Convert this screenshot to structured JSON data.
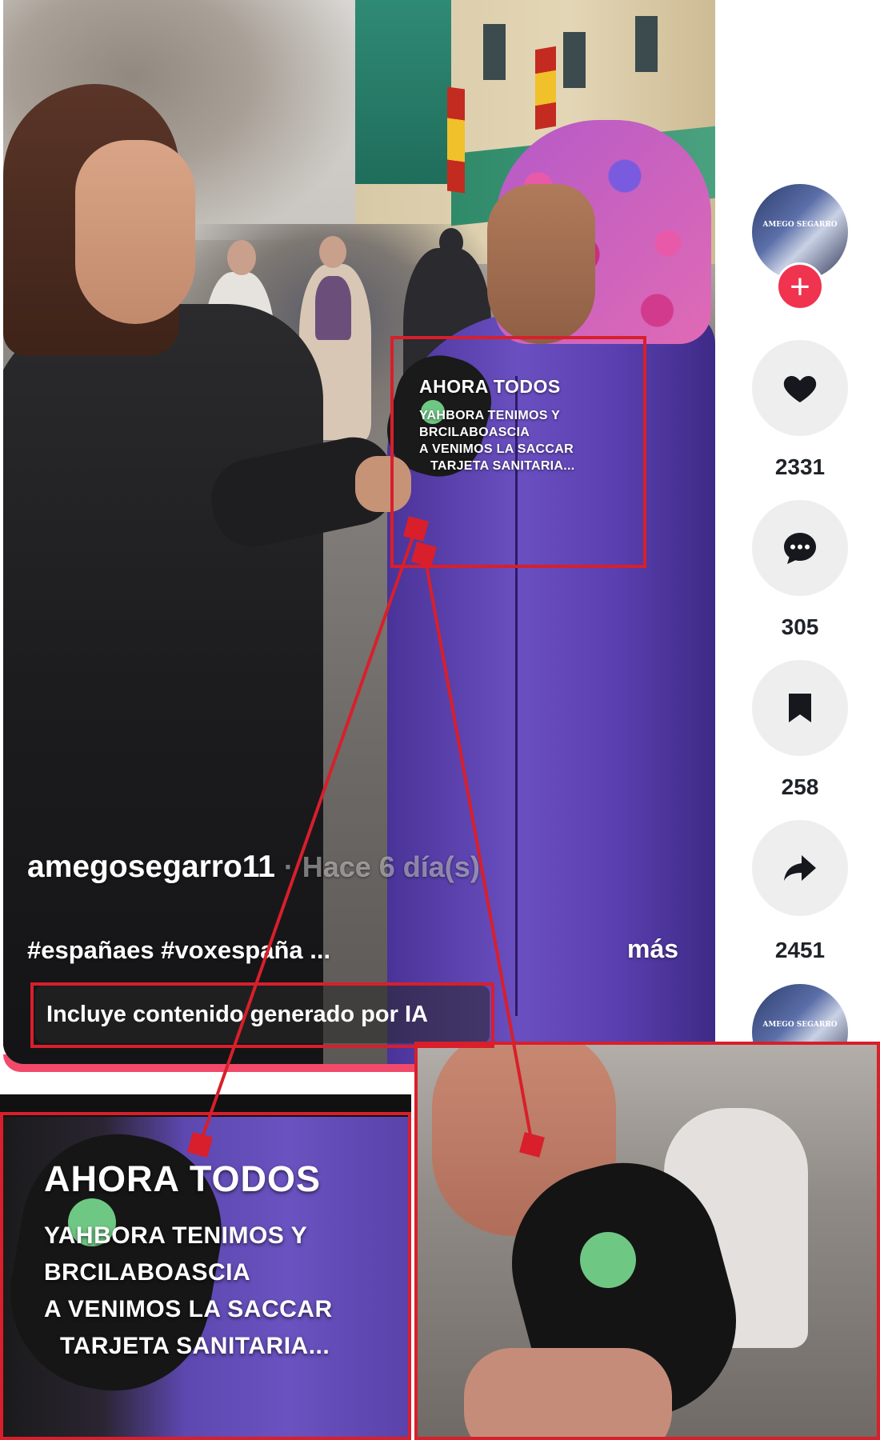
{
  "video": {
    "caption_overlay": {
      "heading": "AHORA TODOS",
      "line1": "YAHBORA TENIMOS Y",
      "line2": "BRCILABOASCIA",
      "line3": "A VENIMOS LA SACCAR",
      "line4": "TARJETA SANITARIA..."
    },
    "username": "amegosegarro11",
    "separator": "·",
    "posted": "Hace 6 día(s)",
    "hashtags": "#españaes #voxespaña ...",
    "more": "más",
    "ai_label": "Incluye contenido generado por IA"
  },
  "rail": {
    "avatar_text": "AMEGO SEGARRO",
    "follow": "+",
    "likes": "2331",
    "comments": "305",
    "saves": "258",
    "shares": "2451",
    "icons": [
      "heart-icon",
      "comment-icon",
      "bookmark-icon",
      "share-icon"
    ]
  },
  "zoom": {
    "heading": "AHORA TODOS",
    "line1": "YAHBORA TENIMOS Y",
    "line2": "BRCILABOASCIA",
    "line3": "A VENIMOS LA SACCAR",
    "line4": "TARJETA SANITARIA..."
  },
  "colors": {
    "annotation": "#d81f2b",
    "follow": "#f0334f",
    "underline": "#f24a6b"
  }
}
